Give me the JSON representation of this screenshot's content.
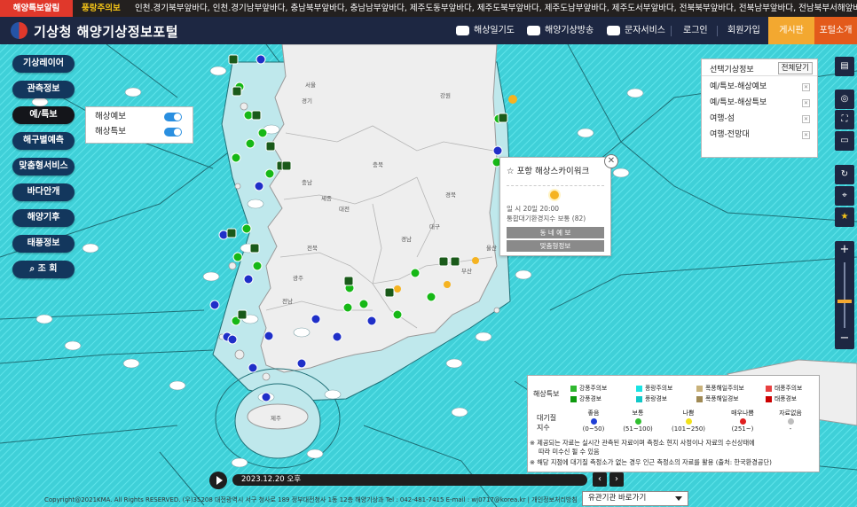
{
  "alertbar": {
    "tag": "해양특보알림",
    "level": "풍랑주의보",
    "areas": "인천.경기북부앞바다, 인천.경기남부앞바다, 충남북부앞바다, 충남남부앞바다, 제주도동부앞바다, 제주도북부앞바다, 제주도남부앞바다, 제주도서부앞바다, 전북북부앞바다, 전북남부앞바다, 전남북부서해앞바다, 전남"
  },
  "nav": {
    "site_title": "기상청 해양기상정보포털",
    "items": [
      {
        "label": "해상일기도",
        "icon": "cloud-icon"
      },
      {
        "label": "해양기상방송",
        "icon": "radio-icon"
      },
      {
        "label": "문자서비스",
        "icon": "message-icon"
      },
      {
        "label": "로그인"
      },
      {
        "label": "회원가입"
      }
    ],
    "bulletin": "게시판",
    "portal_intro": "포털소개"
  },
  "left_menu": [
    {
      "label": "기상레이어",
      "active": false
    },
    {
      "label": "관측정보",
      "active": false
    },
    {
      "label": "예/특보",
      "active": true
    },
    {
      "label": "해구별예측",
      "active": false
    },
    {
      "label": "맞춤형서비스",
      "active": false
    },
    {
      "label": "바다안개",
      "active": false
    },
    {
      "label": "해양기후",
      "active": false
    },
    {
      "label": "태풍정보",
      "active": false
    },
    {
      "label": "조 회",
      "icon": "search-icon",
      "active": false
    }
  ],
  "submenu": [
    {
      "label": "해상예보",
      "on": true
    },
    {
      "label": "해상특보",
      "on": true
    }
  ],
  "selected_panel": {
    "title": "선택기상정보",
    "clear_label": "전체닫기",
    "items": [
      "예/특보-해상예보",
      "예/특보-해상특보",
      "여행-섬",
      "여행-전망대"
    ]
  },
  "map_labels": [
    "서울",
    "경기",
    "강원",
    "충북",
    "충남",
    "세종",
    "대전",
    "경북",
    "대구",
    "전북",
    "광주",
    "전남",
    "경남",
    "울산",
    "부산",
    "제주"
  ],
  "popup": {
    "title": "포항 해상스카이워크",
    "datetime": "일 시 20일 20:00",
    "air_quality": "통합대기환경지수 보통 (82)",
    "button_forecast": "동 네 예 보",
    "button_custom": "맞춤형정보"
  },
  "legend": {
    "marine_header": "해상특보",
    "items": [
      {
        "label": "강풍주의보",
        "color": "#2fb82f"
      },
      {
        "label": "풍랑주의보",
        "color": "#19e3e3"
      },
      {
        "label": "폭풍해일주의보",
        "color": "#c9b27a"
      },
      {
        "label": "태풍주의보",
        "color": "#e84040"
      },
      {
        "label": "강풍경보",
        "color": "#0e9a0e"
      },
      {
        "label": "풍랑경보",
        "color": "#10c8c8"
      },
      {
        "label": "폭풍해일경보",
        "color": "#a08a55"
      },
      {
        "label": "태풍경보",
        "color": "#cc0000"
      }
    ],
    "aq_header": "대기질 지수",
    "aq_levels": [
      {
        "label": "좋음",
        "range": "(0~50)",
        "color": "#1f3fd6"
      },
      {
        "label": "보통",
        "range": "(51~100)",
        "color": "#2fbf2f"
      },
      {
        "label": "나쁨",
        "range": "(101~250)",
        "color": "#f2e21a"
      },
      {
        "label": "매우나쁨",
        "range": "(251~)",
        "color": "#e02020"
      },
      {
        "label": "자료없음",
        "range": "-",
        "color": "#bdbdbd"
      }
    ],
    "note1": "※ 제공되는 자료는 실시간 관측된 자료이며 측정소 현지 사정이나 자료의 수신상태에",
    "note1b": "따라 미수신 될 수 있음",
    "note2": "※ 해당 지점에 대기질 측정소가 없는 경우 인근 측정소의 자료를 활용 (출처: 한국환경공단)"
  },
  "timeline": {
    "datetime": "2023.12.20 오후"
  },
  "footer": {
    "copyright": "Copyright@2021KMA. All Rights RESERVED.  (우)35208 대전광역시 서구 청사로 189 정부대전청사 1동 12층 해양기상과 Tel : 042-481-7415 E-mail : wj0717@korea.kr  | 개인정보처리방침",
    "site_select": "유관기관 바로가기"
  },
  "colors": {
    "sea": "#3fd0d8",
    "land": "#eeeeee",
    "header": "#1d2742",
    "alert": "#e0382b",
    "bulletin": "#f3a830",
    "portal": "#e35a1b"
  }
}
